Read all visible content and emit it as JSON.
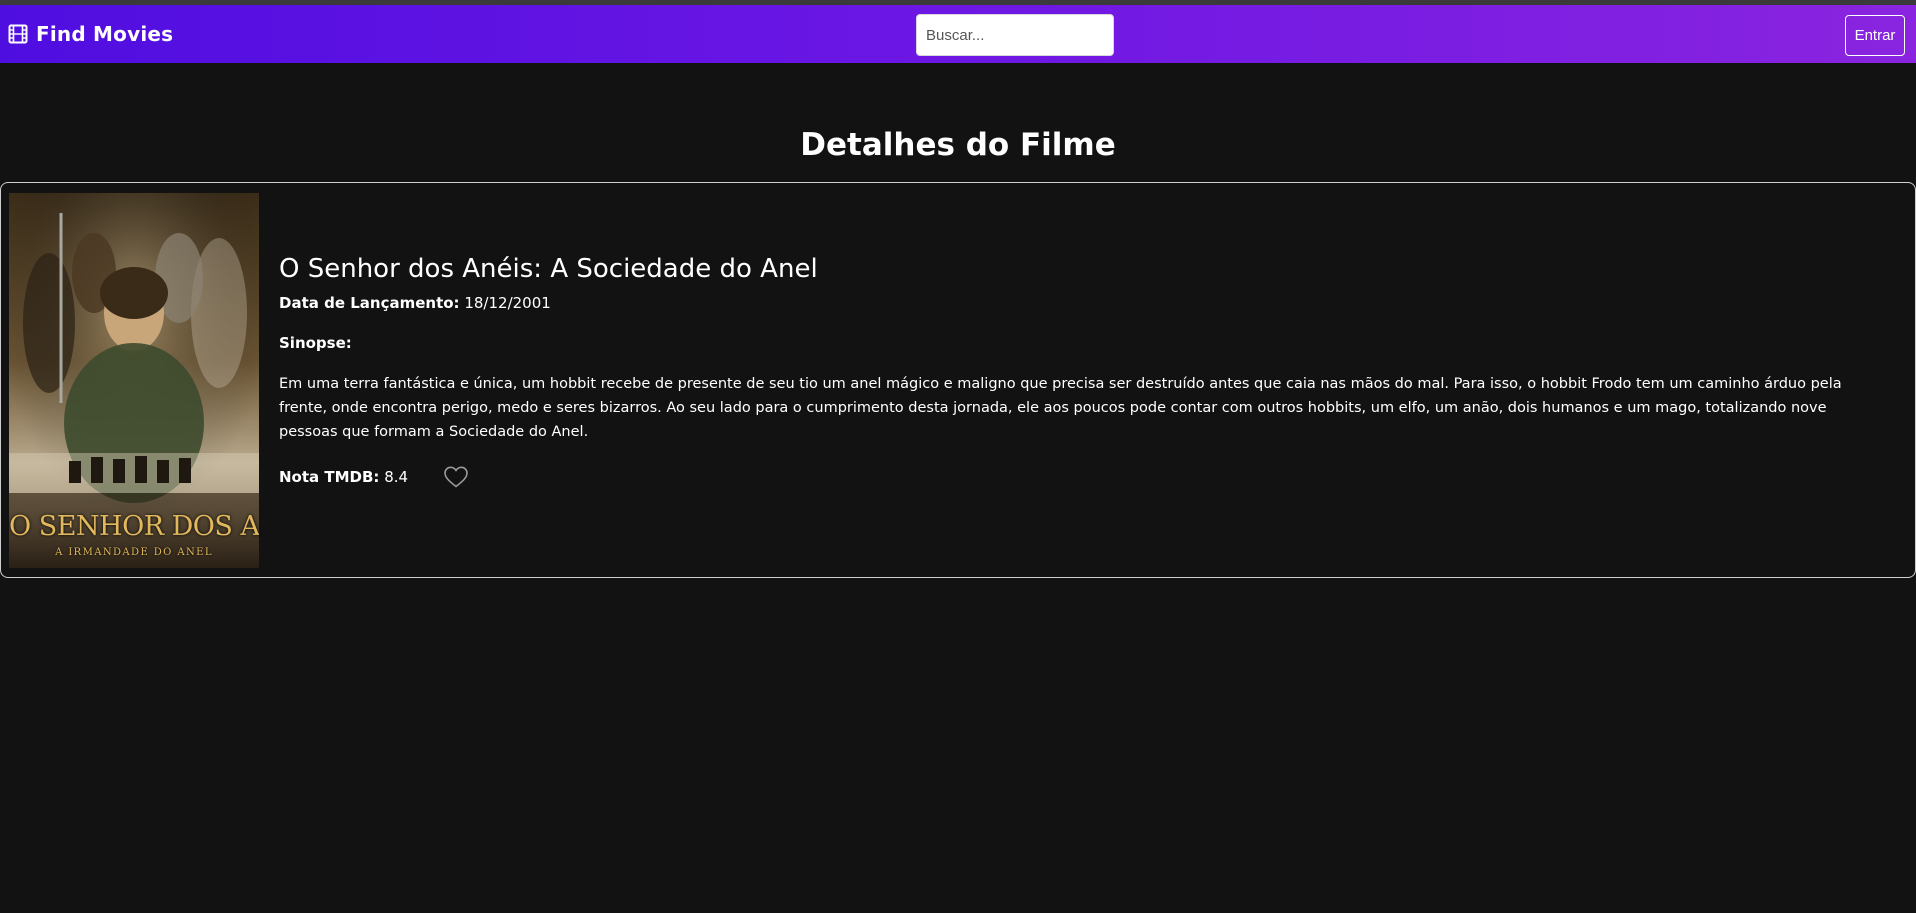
{
  "navbar": {
    "brand": "Find Movies",
    "brand_icon": "film-icon",
    "search_placeholder": "Buscar...",
    "login_label": "Entrar",
    "colors": {
      "gradient_start": "#4f0ee0",
      "gradient_end": "#8a24e0"
    }
  },
  "page": {
    "title": "Detalhes do Filme",
    "background": "#121212"
  },
  "movie": {
    "title": "O Senhor dos Anéis: A Sociedade do Anel",
    "poster": {
      "title_line1": "O SENHOR DOS ANÉIS",
      "title_line2": "A IRMANDADE DO ANEL"
    },
    "release_label": "Data de Lançamento:",
    "release_date": "18/12/2001",
    "synopsis_label": "Sinopse:",
    "synopsis": "Em uma terra fantástica e única, um hobbit recebe de presente de seu tio um anel mágico e maligno que precisa ser destruído antes que caia nas mãos do mal. Para isso, o hobbit Frodo tem um caminho árduo pela frente, onde encontra perigo, medo e seres bizarros. Ao seu lado para o cumprimento desta jornada, ele aos poucos pode contar com outros hobbits, um elfo, um anão, dois humanos e um mago, totalizando nove pessoas que formam a Sociedade do Anel.",
    "rating_label": "Nota TMDB:",
    "rating_value": "8.4",
    "favorite_icon": "heart-outline-icon",
    "favorited": false
  }
}
